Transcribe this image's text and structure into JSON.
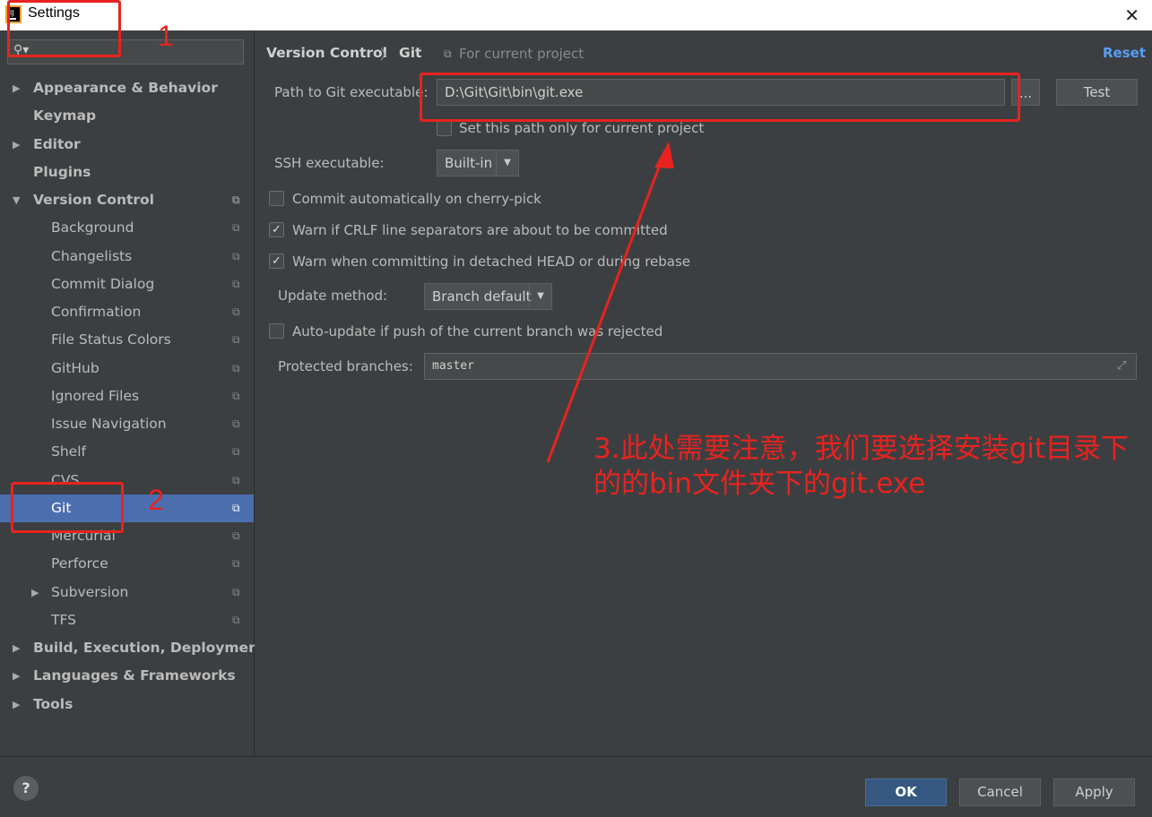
{
  "window": {
    "title": "Settings"
  },
  "search": {
    "placeholder": ""
  },
  "tree": [
    {
      "label": "Appearance & Behavior",
      "level": 0,
      "arrow": "▶",
      "project": false
    },
    {
      "label": "Keymap",
      "level": 0,
      "arrow": "",
      "project": false
    },
    {
      "label": "Editor",
      "level": 0,
      "arrow": "▶",
      "project": false
    },
    {
      "label": "Plugins",
      "level": 0,
      "arrow": "",
      "project": false
    },
    {
      "label": "Version Control",
      "level": 0,
      "arrow": "▼",
      "project": true
    },
    {
      "label": "Background",
      "level": 1,
      "arrow": "",
      "project": true
    },
    {
      "label": "Changelists",
      "level": 1,
      "arrow": "",
      "project": true
    },
    {
      "label": "Commit Dialog",
      "level": 1,
      "arrow": "",
      "project": true
    },
    {
      "label": "Confirmation",
      "level": 1,
      "arrow": "",
      "project": true
    },
    {
      "label": "File Status Colors",
      "level": 1,
      "arrow": "",
      "project": true
    },
    {
      "label": "GitHub",
      "level": 1,
      "arrow": "",
      "project": true
    },
    {
      "label": "Ignored Files",
      "level": 1,
      "arrow": "",
      "project": true
    },
    {
      "label": "Issue Navigation",
      "level": 1,
      "arrow": "",
      "project": true
    },
    {
      "label": "Shelf",
      "level": 1,
      "arrow": "",
      "project": true
    },
    {
      "label": "CVS",
      "level": 1,
      "arrow": "",
      "project": true
    },
    {
      "label": "Git",
      "level": 1,
      "arrow": "",
      "project": true,
      "selected": true
    },
    {
      "label": "Mercurial",
      "level": 1,
      "arrow": "",
      "project": true
    },
    {
      "label": "Perforce",
      "level": 1,
      "arrow": "",
      "project": true
    },
    {
      "label": "Subversion",
      "level": 1,
      "arrow": "▶",
      "project": true
    },
    {
      "label": "TFS",
      "level": 1,
      "arrow": "",
      "project": true
    },
    {
      "label": "Build, Execution, Deployment",
      "level": 0,
      "arrow": "▶",
      "project": false
    },
    {
      "label": "Languages & Frameworks",
      "level": 0,
      "arrow": "▶",
      "project": false
    },
    {
      "label": "Tools",
      "level": 0,
      "arrow": "▶",
      "project": false
    }
  ],
  "breadcrumb": {
    "parent": "Version Control",
    "separator": "〉",
    "current": "Git",
    "scope": "For current project"
  },
  "reset_label": "Reset",
  "git": {
    "path_label": "Path to Git executable:",
    "path_value": "D:\\Git\\Git\\bin\\git.exe",
    "browse_label": "...",
    "test_label": "Test",
    "set_path_label": "Set this path only for current project",
    "ssh_label": "SSH executable:",
    "ssh_value": "Built-in",
    "cherry_pick_label": "Commit automatically on cherry-pick",
    "crlf_label": "Warn if CRLF line separators are about to be committed",
    "detached_label": "Warn when committing in detached HEAD or during rebase",
    "update_method_label": "Update method:",
    "update_method_value": "Branch default",
    "auto_update_label": "Auto-update if push of the current branch was rejected",
    "protected_label": "Protected branches:",
    "protected_value": "master",
    "checks": {
      "set_path": "",
      "cherry_pick": "",
      "crlf": "✓",
      "detached": "✓",
      "auto_update": ""
    }
  },
  "buttons": {
    "ok": "OK",
    "cancel": "Cancel",
    "apply": "Apply",
    "help": "?"
  },
  "annotations": {
    "n1": "1",
    "n2": "2",
    "note": "3.此处需要注意，我们要选择安装git目录下的的bin文件夹下的git.exe",
    "color": "#e8231f"
  }
}
